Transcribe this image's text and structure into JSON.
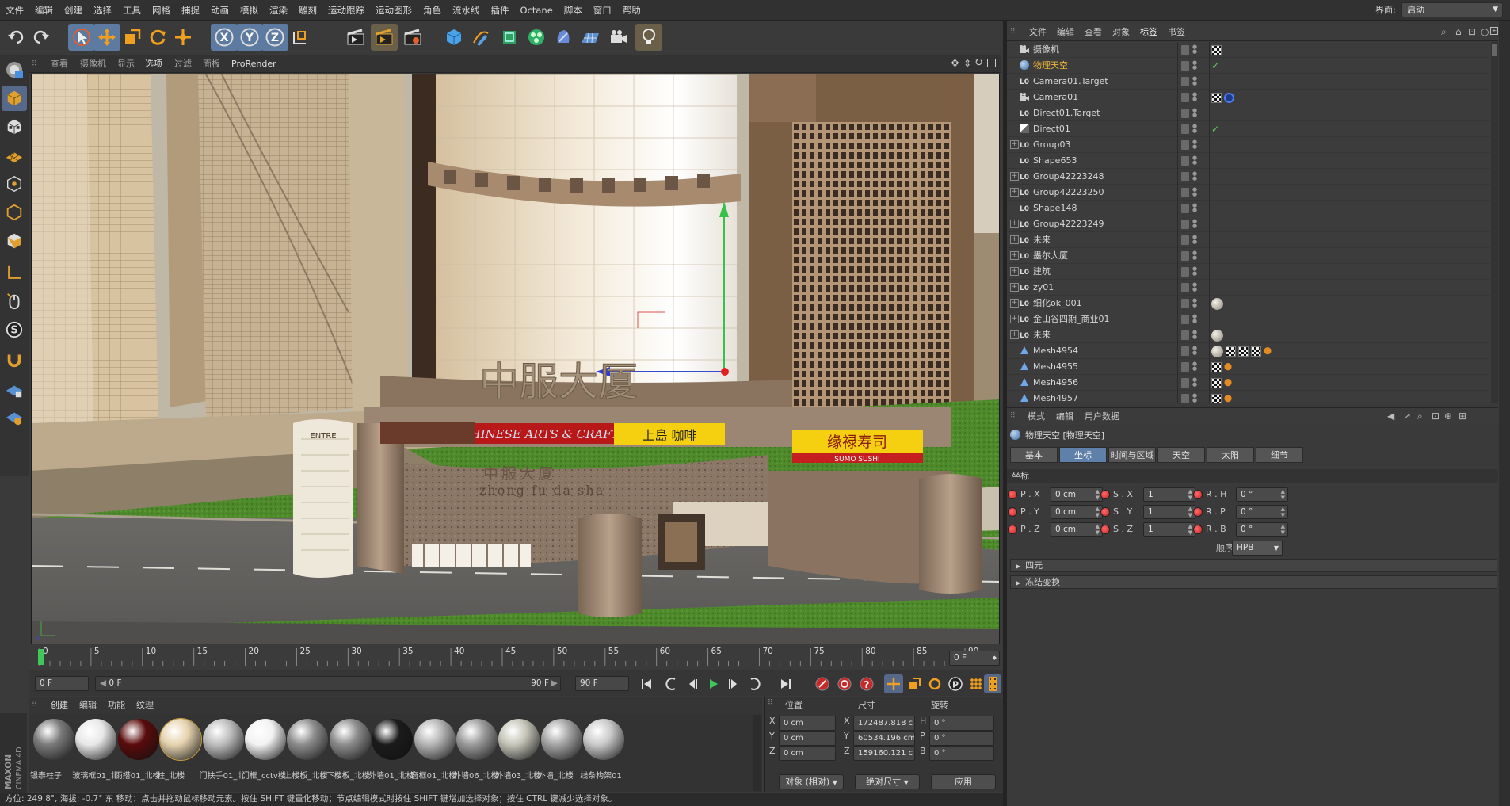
{
  "menu": [
    "文件",
    "编辑",
    "创建",
    "选择",
    "工具",
    "网格",
    "捕捉",
    "动画",
    "模拟",
    "渲染",
    "雕刻",
    "运动跟踪",
    "运动图形",
    "角色",
    "流水线",
    "插件",
    "Octane",
    "脚本",
    "窗口",
    "帮助"
  ],
  "layout": {
    "label": "界面:",
    "value": "启动"
  },
  "viewport_menu": [
    "查看",
    "摄像机",
    "显示",
    "选项",
    "过滤",
    "面板",
    "ProRender"
  ],
  "timeline": {
    "ticks": [
      "0",
      "5",
      "10",
      "15",
      "20",
      "25",
      "30",
      "35",
      "40",
      "45",
      "50",
      "55",
      "60",
      "65",
      "70",
      "75",
      "80",
      "85",
      "90"
    ],
    "current_frame_field": "0 F"
  },
  "transport": {
    "start": "0 F",
    "scrub_start": "0 F",
    "scrub_end": "90 F",
    "end": "90 F"
  },
  "material_manager": {
    "menu": [
      "创建",
      "编辑",
      "功能",
      "纹理"
    ],
    "materials": [
      {
        "label": "银泰柱子",
        "color": "#7a7a7a"
      },
      {
        "label": "玻璃框01_北",
        "color": "#e8e8e8"
      },
      {
        "label": "雨搭01_北楼",
        "color": "#5a0b0b"
      },
      {
        "label": "柱_北楼",
        "color": "#e6d3ae"
      },
      {
        "label": "门扶手01_北",
        "color": "#bdbdbd"
      },
      {
        "label": "门框_cctv楼",
        "color": "#f2f2f2"
      },
      {
        "label": "上楼板_北楼",
        "color": "#8c8c8c"
      },
      {
        "label": "下楼板_北楼",
        "color": "#8c8c8c"
      },
      {
        "label": "外墙01_北楼",
        "color": "#1b1b1b"
      },
      {
        "label": "窗框01_北楼",
        "color": "#b4b4b4"
      },
      {
        "label": "外墙06_北楼",
        "color": "#9a9a9a"
      },
      {
        "label": "外墙03_北楼",
        "color": "#c4c4b8"
      },
      {
        "label": "外墙_北楼",
        "color": "#a4a4a4"
      },
      {
        "label": "线条构架01",
        "color": "#c9c9c9"
      }
    ]
  },
  "coordinates": {
    "headers": [
      "位置",
      "尺寸",
      "旋转"
    ],
    "rows": [
      {
        "axis": "X",
        "pos": "0 cm",
        "size_label": "X",
        "size": "172487.818 c",
        "rot_label": "H",
        "rot": "0 °"
      },
      {
        "axis": "Y",
        "pos": "0 cm",
        "size_label": "Y",
        "size": "60534.196 cm",
        "rot_label": "P",
        "rot": "0 °"
      },
      {
        "axis": "Z",
        "pos": "0 cm",
        "size_label": "Z",
        "size": "159160.121 c",
        "rot_label": "B",
        "rot": "0 °"
      }
    ],
    "mode_select": "对象 (相对)",
    "size_select": "绝对尺寸",
    "apply": "应用"
  },
  "status_bar": "方位: 249.8°, 海拔: -0.7° 东    移动：点击并拖动鼠标移动元素。按住 SHIFT 键量化移动；节点编辑模式时按住 SHIFT 键增加选择对象；按住 CTRL 键减少选择对象。",
  "object_manager": {
    "menu": [
      "文件",
      "编辑",
      "查看",
      "对象",
      "标签",
      "书签"
    ],
    "objects": [
      {
        "name": "摄像机",
        "icon": "camera",
        "expand": false,
        "hl": false,
        "tags": [
          "chk"
        ]
      },
      {
        "name": "物理天空",
        "icon": "sky",
        "expand": false,
        "hl": true,
        "tags": [
          "green"
        ]
      },
      {
        "name": "Camera01.Target",
        "icon": "null",
        "expand": false,
        "hl": false,
        "tags": []
      },
      {
        "name": "Camera01",
        "icon": "camera",
        "expand": false,
        "hl": false,
        "tags": [
          "chk",
          "blue"
        ]
      },
      {
        "name": "Direct01.Target",
        "icon": "null",
        "expand": false,
        "hl": false,
        "tags": []
      },
      {
        "name": "Direct01",
        "icon": "light",
        "expand": false,
        "hl": false,
        "tags": [
          "green"
        ]
      },
      {
        "name": "Group03",
        "icon": "null",
        "expand": true,
        "hl": false,
        "tags": []
      },
      {
        "name": "Shape653",
        "icon": "null",
        "expand": false,
        "hl": false,
        "tags": []
      },
      {
        "name": "Group42223248",
        "icon": "null",
        "expand": true,
        "hl": false,
        "tags": []
      },
      {
        "name": "Group42223250",
        "icon": "null",
        "expand": true,
        "hl": false,
        "tags": []
      },
      {
        "name": "Shape148",
        "icon": "null",
        "expand": false,
        "hl": false,
        "tags": []
      },
      {
        "name": "Group42223249",
        "icon": "null",
        "expand": true,
        "hl": false,
        "tags": []
      },
      {
        "name": "未来",
        "icon": "null",
        "expand": true,
        "hl": false,
        "tags": []
      },
      {
        "name": "墨尔大厦",
        "icon": "null",
        "expand": true,
        "hl": false,
        "tags": []
      },
      {
        "name": "建筑",
        "icon": "null",
        "expand": true,
        "hl": false,
        "tags": []
      },
      {
        "name": "zy01",
        "icon": "null",
        "expand": true,
        "hl": false,
        "tags": []
      },
      {
        "name": "细化ok_001",
        "icon": "null",
        "expand": true,
        "hl": false,
        "tags": [
          "ball"
        ]
      },
      {
        "name": "金山谷四期_商业01",
        "icon": "null",
        "expand": true,
        "hl": false,
        "tags": []
      },
      {
        "name": "未来",
        "icon": "null",
        "expand": true,
        "hl": false,
        "tags": [
          "ball"
        ]
      },
      {
        "name": "Mesh4954",
        "icon": "mesh",
        "expand": false,
        "hl": false,
        "tags": [
          "ball",
          "chk",
          "chk",
          "chk",
          "tri"
        ]
      },
      {
        "name": "Mesh4955",
        "icon": "mesh",
        "expand": false,
        "hl": false,
        "tags": [
          "chk",
          "tri"
        ]
      },
      {
        "name": "Mesh4956",
        "icon": "mesh",
        "expand": false,
        "hl": false,
        "tags": [
          "chk",
          "tri"
        ]
      },
      {
        "name": "Mesh4957",
        "icon": "mesh",
        "expand": false,
        "hl": false,
        "tags": [
          "chk",
          "tri"
        ]
      }
    ]
  },
  "attribute_manager": {
    "menu": [
      "模式",
      "编辑",
      "用户数据"
    ],
    "title": "物理天空 [物理天空]",
    "tabs": [
      {
        "label": "基本",
        "active": false
      },
      {
        "label": "坐标",
        "active": true
      },
      {
        "label": "时间与区域",
        "active": false
      },
      {
        "label": "天空",
        "active": false
      },
      {
        "label": "太阳",
        "active": false
      },
      {
        "label": "细节",
        "active": false
      }
    ],
    "section": "坐标",
    "params": [
      {
        "p_label": "P . X",
        "p_val": "0 cm",
        "s_label": "S . X",
        "s_val": "1",
        "r_label": "R . H",
        "r_val": "0 °"
      },
      {
        "p_label": "P . Y",
        "p_val": "0 cm",
        "s_label": "S . Y",
        "s_val": "1",
        "r_label": "R . P",
        "r_val": "0 °"
      },
      {
        "p_label": "P . Z",
        "p_val": "0 cm",
        "s_label": "S . Z",
        "s_val": "1",
        "r_label": "R . B",
        "r_val": "0 °"
      }
    ],
    "order_label": "顺序",
    "order_value": "HPB",
    "groups": [
      "四元",
      "冻结变换"
    ]
  },
  "viewport_scene": {
    "sign_main": "中服大厦",
    "sign_pinyin": "zhong fu da sha",
    "sign_arts": "CHINESE ARTS & CRAFTS",
    "sign_cafe": "上島 咖啡",
    "sign_sushi": "缘禄寿司",
    "sign_sushi_en": "SUMO SUSHI",
    "sign_entre": "ENTRE"
  },
  "maxon_logo": "MAXON CINEMA 4D"
}
